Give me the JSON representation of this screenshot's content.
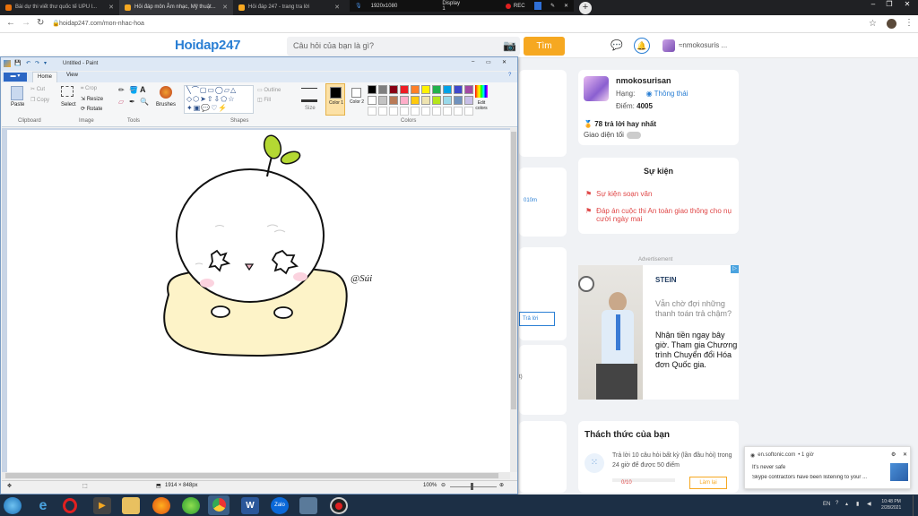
{
  "browser": {
    "tabs": [
      {
        "label": "Bài dự thi viết thư quốc tế UPU l..."
      },
      {
        "label": "Hỏi đáp môn Âm nhạc, Mỹ thuật..."
      },
      {
        "label": "Hỏi đáp 247 - trang tra lời"
      }
    ],
    "recorder": {
      "resolution": "1920x1080",
      "display": "Display 1",
      "rec": "REC"
    },
    "url": "hoidap247.com/mon-nhac-hoa"
  },
  "site": {
    "logo": "Hoidap247",
    "search_placeholder": "Câu hỏi của bạn là gì?",
    "search_button": "Tìm",
    "username_header": "≈nmokosuris ...",
    "profile": {
      "name": "nmokosurisan",
      "rank_label": "Hạng:",
      "rank_value": "Thông thái",
      "points_label": "Điểm:",
      "points_value": "4005",
      "best_answers": "78 trả lời hay nhất",
      "dark_mode": "Giao diện tối"
    },
    "events": {
      "title": "Sự kiện",
      "items": [
        "Sự kiện soạn văn",
        "Đáp án cuộc thi An toàn giao thông cho nụ cười ngày mai"
      ]
    },
    "ad": {
      "label": "Advertisement",
      "brand": "STEIN",
      "text_gray": "Vẫn chờ đợi những thanh toán trả chậm?",
      "text_black": "Nhận tiền ngay bây giờ. Tham gia Chương trình Chuyển đổi Hóa đơn Quốc gia."
    },
    "challenge": {
      "title": "Thách thức của bạn",
      "text": "Trả lời 10 câu hỏi  bất kỳ (lần đầu hỏi) trong 24 giờ để được 50 điểm",
      "progress": "0/10",
      "action": "Làm lại",
      "progress_value": 0
    },
    "partial": {
      "time": "010m",
      "reply": "Trả lời",
      "suffix": "t)"
    }
  },
  "notification": {
    "source": "en.softonic.com",
    "time": "• 1 giờ",
    "line1": "It's never safe",
    "line2": "Skype contractors have been listening to your ..."
  },
  "paint": {
    "title": "Untitled - Paint",
    "tabs": [
      "Home",
      "View"
    ],
    "groups": [
      "Clipboard",
      "Image",
      "Tools",
      "Shapes",
      "Colors"
    ],
    "clipboard": {
      "paste": "Paste",
      "cut": "Cut",
      "copy": "Copy"
    },
    "image": {
      "select": "Select",
      "crop": "Crop",
      "resize": "Resize",
      "rotate": "Rotate"
    },
    "brushes": "Brushes",
    "shapes": {
      "outline": "Outline",
      "fill": "Fill"
    },
    "size": "Size",
    "color1": "Color 1",
    "color2": "Color 2",
    "edit_colors": "Edit colors",
    "palette": [
      "#000000",
      "#7f7f7f",
      "#880015",
      "#ed1c24",
      "#ff7f27",
      "#fff200",
      "#22b14c",
      "#00a2e8",
      "#3f48cc",
      "#a349a4",
      "#ffffff",
      "#c3c3c3",
      "#b97a57",
      "#ffaec9",
      "#ffc90e",
      "#efe4b0",
      "#b5e61d",
      "#99d9ea",
      "#7092be",
      "#c8bfe7"
    ],
    "signature": "@Súi",
    "status_size": "1914 × 848px",
    "zoom": "100%"
  },
  "taskbar": {
    "lang": "EN",
    "time": "10:48 PM",
    "date": "2/28/2021"
  }
}
